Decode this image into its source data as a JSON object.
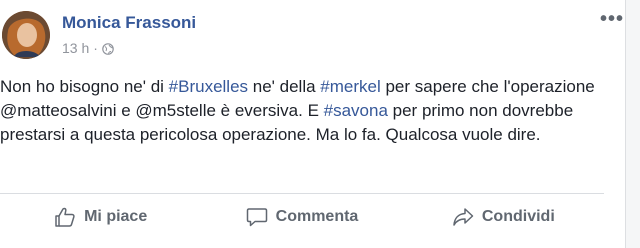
{
  "post": {
    "author": "Monica Frassoni",
    "time": "13 h",
    "separator": "·",
    "privacy_icon": "globe-icon",
    "more_icon": "more-options-icon",
    "more_label": "•••",
    "body": {
      "t1": "Non ho bisogno ne' di ",
      "h1": "#Bruxelles",
      "t2": " ne' della ",
      "h2": "#merkel",
      "t3": " per sapere che l'operazione @matteosalvini e @m5stelle è eversiva. E ",
      "h3": "#savona",
      "t4": " per primo non dovrebbe prestarsi a questa pericolosa operazione. Ma lo fa. Qualcosa vuole dire."
    }
  },
  "actions": {
    "like": {
      "label": "Mi piace",
      "icon": "thumbs-up-icon"
    },
    "comment": {
      "label": "Commenta",
      "icon": "comment-icon"
    },
    "share": {
      "label": "Condividi",
      "icon": "share-icon"
    }
  },
  "colors": {
    "link": "#365899",
    "text": "#1d2129",
    "muted": "#90949c",
    "action": "#606770"
  }
}
